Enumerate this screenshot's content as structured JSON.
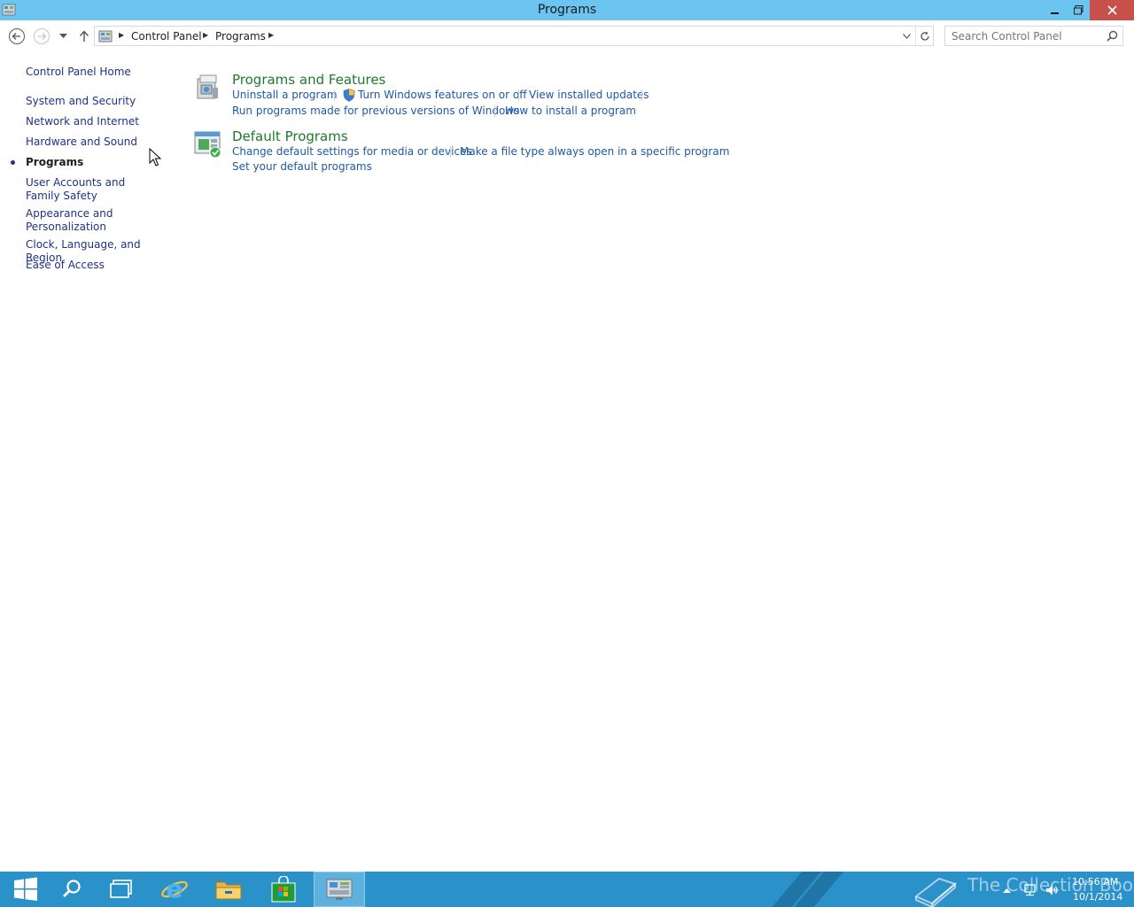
{
  "window": {
    "title": "Programs"
  },
  "breadcrumb": {
    "items": [
      "Control Panel",
      "Programs"
    ]
  },
  "search": {
    "placeholder": "Search Control Panel"
  },
  "sidebar": {
    "items": [
      {
        "label": "Control Panel Home"
      },
      {
        "label": "System and Security"
      },
      {
        "label": "Network and Internet"
      },
      {
        "label": "Hardware and Sound"
      },
      {
        "label": "Programs",
        "current": true
      },
      {
        "label": "User Accounts and Family Safety"
      },
      {
        "label": "Appearance and Personalization"
      },
      {
        "label": "Clock, Language, and Region"
      },
      {
        "label": "Ease of Access"
      }
    ]
  },
  "groups": [
    {
      "title": "Programs and Features",
      "icon": "programs-and-features-icon",
      "links": [
        "Uninstall a program",
        "Turn Windows features on or off",
        "View installed updates",
        "Run programs made for previous versions of Windows",
        "How to install a program"
      ]
    },
    {
      "title": "Default Programs",
      "icon": "default-programs-icon",
      "links": [
        "Change default settings for media or devices",
        "Make a file type always open in a specific program",
        "Set your default programs"
      ]
    }
  ],
  "taskbar": {
    "watermark": "The Collection Book",
    "time": "10:56 AM",
    "date": "10/1/2014",
    "accent_color": "#2b91c9"
  },
  "colors": {
    "titlebar": "#6cc5f0",
    "group_title": "#1d7a2a",
    "link": "#1e59a8",
    "nav_link": "#1e3287",
    "close_button": "#c7504b"
  }
}
